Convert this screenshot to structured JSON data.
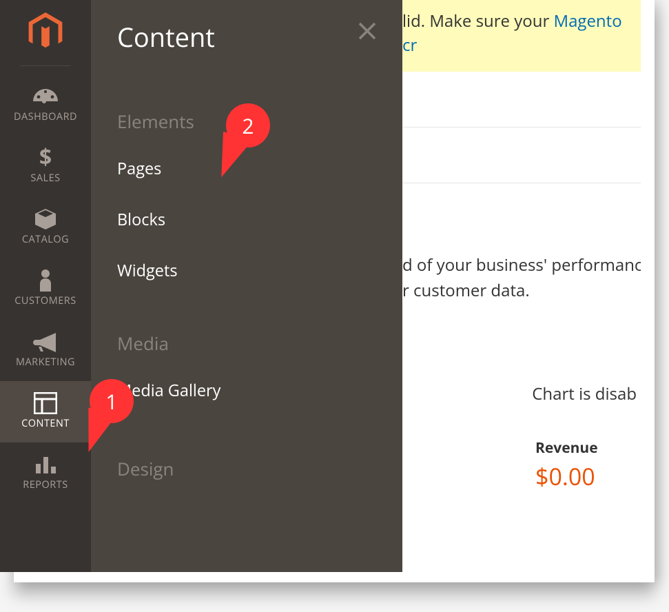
{
  "sidebar": {
    "items": [
      {
        "label": "DASHBOARD"
      },
      {
        "label": "SALES"
      },
      {
        "label": "CATALOG"
      },
      {
        "label": "CUSTOMERS"
      },
      {
        "label": "MARKETING"
      },
      {
        "label": "CONTENT"
      },
      {
        "label": "REPORTS"
      }
    ]
  },
  "submenu": {
    "title": "Content",
    "groups": {
      "elements": {
        "title": "Elements",
        "items": [
          "Pages",
          "Blocks",
          "Widgets"
        ]
      },
      "media": {
        "title": "Media",
        "items": [
          "Media Gallery"
        ]
      },
      "design": {
        "title": "Design"
      }
    }
  },
  "alert": {
    "suffix_before_link": "lid. Make sure your ",
    "link": "Magento cr"
  },
  "main": {
    "bi_text_line1": "d of your business' performanc",
    "bi_text_line2": "r customer data.",
    "chart_note": "Chart is disab",
    "revenue_label": "Revenue",
    "revenue_value": "$0.00"
  },
  "callouts": {
    "one": "1",
    "two": "2"
  },
  "colors": {
    "accent": "#eb5202",
    "callout": "#ff3333",
    "link": "#006bb4",
    "alert_bg": "#fffbbb"
  }
}
